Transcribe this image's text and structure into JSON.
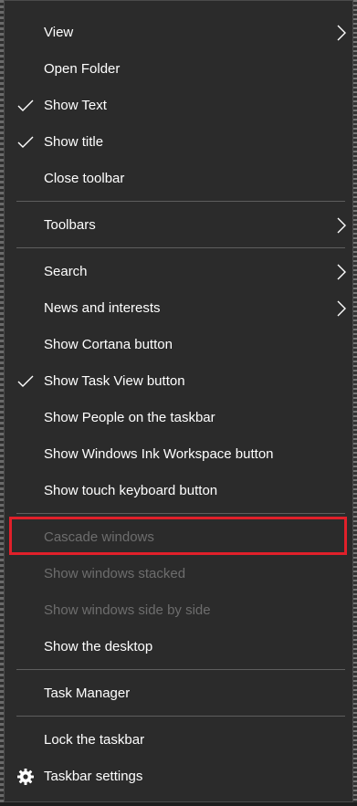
{
  "menu": {
    "items": [
      {
        "label": "View",
        "checked": false,
        "submenu": true,
        "enabled": true
      },
      {
        "label": "Open Folder",
        "checked": false,
        "submenu": false,
        "enabled": true
      },
      {
        "label": "Show Text",
        "checked": true,
        "submenu": false,
        "enabled": true
      },
      {
        "label": "Show title",
        "checked": true,
        "submenu": false,
        "enabled": true
      },
      {
        "label": "Close toolbar",
        "checked": false,
        "submenu": false,
        "enabled": true
      },
      {
        "label": "Toolbars",
        "checked": false,
        "submenu": true,
        "enabled": true
      },
      {
        "label": "Search",
        "checked": false,
        "submenu": true,
        "enabled": true
      },
      {
        "label": "News and interests",
        "checked": false,
        "submenu": true,
        "enabled": true
      },
      {
        "label": "Show Cortana button",
        "checked": false,
        "submenu": false,
        "enabled": true
      },
      {
        "label": "Show Task View button",
        "checked": true,
        "submenu": false,
        "enabled": true
      },
      {
        "label": "Show People on the taskbar",
        "checked": false,
        "submenu": false,
        "enabled": true
      },
      {
        "label": "Show Windows Ink Workspace button",
        "checked": false,
        "submenu": false,
        "enabled": true
      },
      {
        "label": "Show touch keyboard button",
        "checked": false,
        "submenu": false,
        "enabled": true
      },
      {
        "label": "Cascade windows",
        "checked": false,
        "submenu": false,
        "enabled": false
      },
      {
        "label": "Show windows stacked",
        "checked": false,
        "submenu": false,
        "enabled": false
      },
      {
        "label": "Show windows side by side",
        "checked": false,
        "submenu": false,
        "enabled": false
      },
      {
        "label": "Show the desktop",
        "checked": false,
        "submenu": false,
        "enabled": true
      },
      {
        "label": "Task Manager",
        "checked": false,
        "submenu": false,
        "enabled": true
      },
      {
        "label": "Lock the taskbar",
        "checked": false,
        "submenu": false,
        "enabled": true
      },
      {
        "label": "Taskbar settings",
        "checked": false,
        "submenu": false,
        "enabled": true,
        "icon": "gear-icon"
      }
    ]
  },
  "colors": {
    "menu_background": "#2b2b2b",
    "text": "#ffffff",
    "disabled_text": "#6d6d6d",
    "separator": "#5e5e5e",
    "highlight_box": "#e0202a"
  }
}
